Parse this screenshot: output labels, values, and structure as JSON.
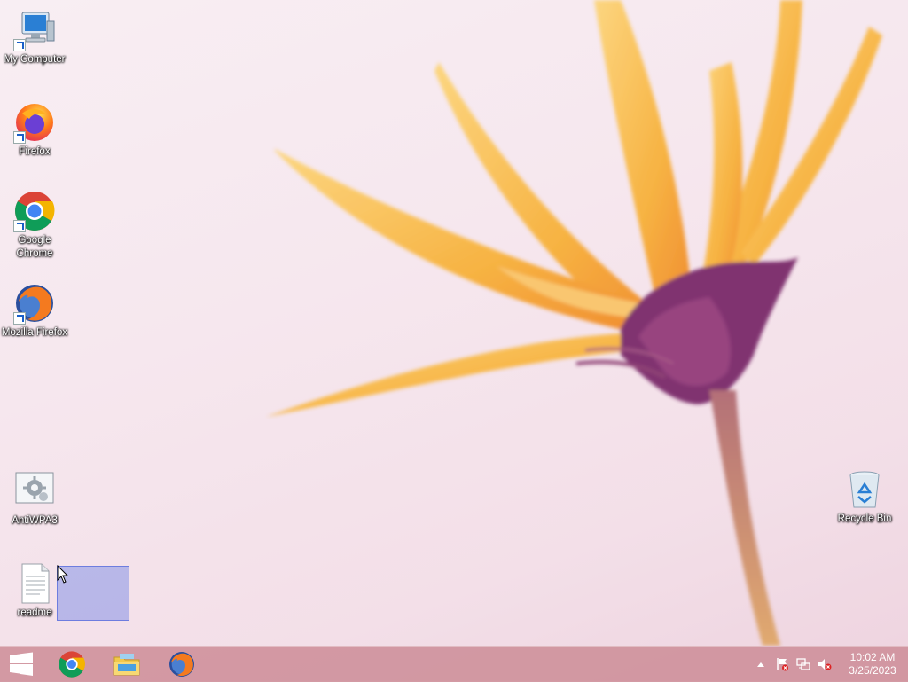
{
  "desktop_icons": {
    "my_computer": "My Computer",
    "firefox": "Firefox",
    "google_chrome": "Google Chrome",
    "mozilla_firefox": "Mozilla Firefox",
    "antiwpa3": "AntiWPA3",
    "readme": "readme",
    "recycle_bin": "Recycle Bin"
  },
  "taskbar": {
    "pinned": [
      "windows-start",
      "google-chrome",
      "file-explorer",
      "firefox"
    ]
  },
  "tray": {
    "icons": [
      "show-hidden-icons",
      "action-center-flag",
      "network",
      "volume-muted"
    ],
    "time": "10:02 AM",
    "date": "3/25/2023"
  },
  "colors": {
    "taskbar": "#cd8c96",
    "petals": "#f5b43c",
    "flower_center": "#7a2a6a",
    "selection": "#8090e0"
  }
}
